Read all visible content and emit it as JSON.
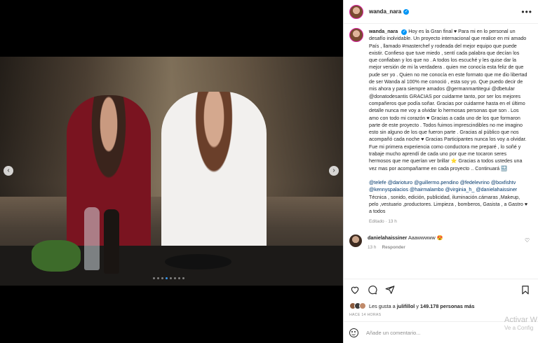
{
  "post": {
    "username": "wanda_nara",
    "caption_username": "wanda_nara",
    "caption_text": "Hoy es la Gran final ♥ Para mi en lo personal un desafío inolvidable. Un proyecto internacional que realice en mi amado País , llamado #masterchef y rodeada del mejor equipo que puede existir. Confieso que tuve miedo , sentí cada palabra que decían los que confiaban y los que no . A todos los escuché y les quise dar la mejor versión de mi la verdadera . quien me conocía esta feliz de que pude ser yo . Quien no me conocía en este formato que me dio libertad de ser Wanda al 100% me conoció , esta soy yo. Que puedo decir de mis ahora y para siempre amados @germanmartitegui @dbetular @donatodesantis GRACIAS por cuidarme tanto, por ser los mejores compañeros que podía soñar. Gracias por cuidarme hasta en el último detalle nunca me voy a olvidar lo hermosas personas que son . Los amo con todo mi corazón ♥ Gracias a cada uno de los que formaron parte de este proyecto . Todos fuimos imprescindibles no me imagino esto sin alguno de los que fueron parte . Gracias al público que nos acompañó cada noche ♥ Gracias Participantes nunca los voy a olvidar. Fue mi primera experiencia como conductora me preparé , lo soñé y trabaje mucho aprendí de cada uno por que me tocaron seres hermosos que me querían ver brillar ⭐ Gracias a todos ustedes una vez mas por acompañarme en cada proyecto .. Continuará 🔜",
    "mentions": "@telefe @darioturo @guillermo.pendino @fedelevrino @boxfishtv @kennyspalacios @hairmalambo @virginia_h_ @danielahaissiner",
    "credits": "Técnica , sonido, edición, publicidad, iluminación.cámaras ,Makeup, pelo ,vestuario ,productores. Limpieza , bomberos, Gasista , a Gastro ♥ a todos",
    "edited": "Editado · 13 h",
    "comment": {
      "username": "danielahaissiner",
      "text": "Aaawwwww 😍",
      "time": "13 h",
      "reply": "Responder"
    },
    "likes_prefix": "Les gusta a",
    "likes_user": "julifillol",
    "likes_and": "y",
    "likes_count": "149.178 personas más",
    "date": "HACE 14 HORAS",
    "comment_placeholder": "Añade un comentario...",
    "carousel": {
      "slides": 8,
      "active": 3
    }
  },
  "watermark": {
    "line1": "Activar W",
    "line2": "Ve a Config"
  }
}
